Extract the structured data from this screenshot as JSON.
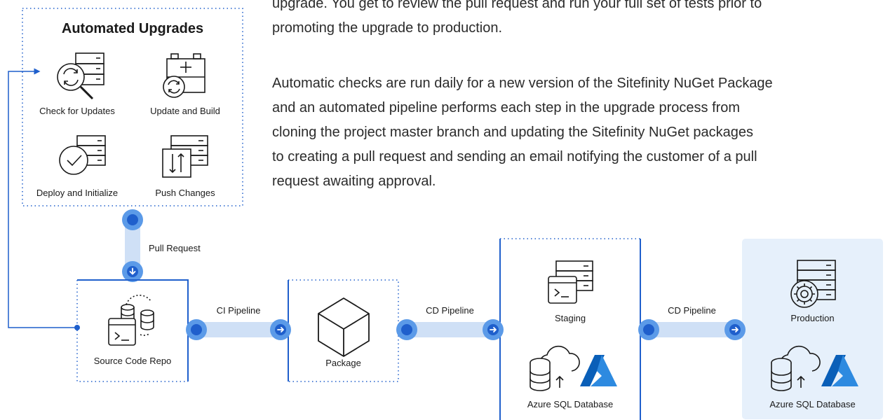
{
  "intro": {
    "line1": "upgrade. You get to review the pull request and run your full set of tests prior to",
    "line2": "promoting the upgrade to production."
  },
  "description": {
    "line1": "Automatic checks are run daily for a new version of the Sitefinity NuGet Package",
    "line2": "and an automated pipeline performs each step in the upgrade process from",
    "line3": "cloning the project master branch and updating the Sitefinity NuGet packages",
    "line4": "to creating a pull request and sending an email notifying the customer of a pull",
    "line5": "request awaiting approval."
  },
  "upgrades_box": {
    "title": "Automated Upgrades",
    "steps": [
      {
        "label": "Check for Updates",
        "icon": "server-refresh-search-icon"
      },
      {
        "label": "Update and Build",
        "icon": "package-build-icon"
      },
      {
        "label": "Deploy and Initialize",
        "icon": "server-check-icon"
      },
      {
        "label": "Push Changes",
        "icon": "server-push-icon"
      }
    ]
  },
  "connectors": {
    "pull_request": "Pull Request",
    "ci_pipeline": "CI Pipeline",
    "cd_pipeline_1": "CD Pipeline",
    "cd_pipeline_2": "CD Pipeline"
  },
  "stages": {
    "source": {
      "label": "Source Code Repo",
      "icon": "terminal-database-icon"
    },
    "package": {
      "label": "Package",
      "icon": "cube-icon"
    },
    "staging": {
      "label": "Staging",
      "db_label": "Azure SQL Database"
    },
    "production": {
      "label": "Production",
      "db_label": "Azure SQL Database"
    }
  },
  "colors": {
    "accent": "#1f5fcc",
    "connector_light": "#cfe0f6",
    "dot_ring": "#5b9ae8",
    "production_bg": "#e6f0fb",
    "azure": "#1e72cf"
  }
}
